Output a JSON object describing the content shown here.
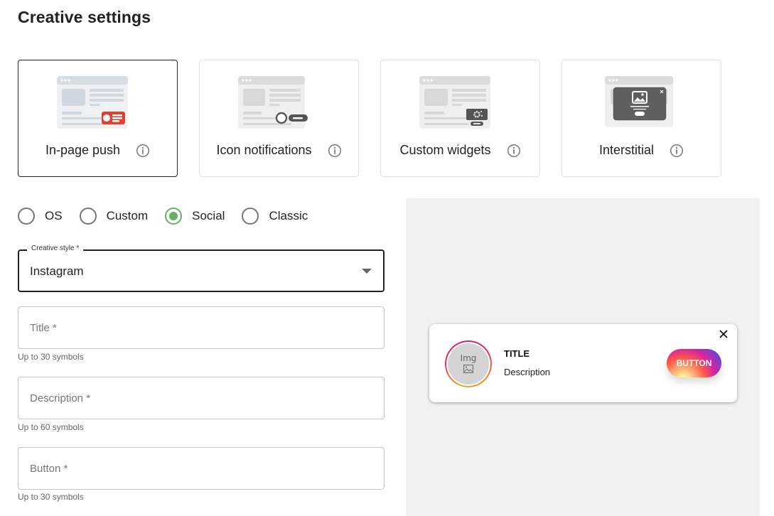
{
  "page": {
    "title": "Creative settings"
  },
  "creative_types": [
    {
      "id": "in-page-push",
      "label": "In-page push",
      "selected": true,
      "illustration": "in-page-push-illustration",
      "accent": "#e0402d"
    },
    {
      "id": "icon-notifications",
      "label": "Icon notifications",
      "selected": false,
      "illustration": "icon-notifications-illustration",
      "accent": "#555555"
    },
    {
      "id": "custom-widgets",
      "label": "Custom widgets",
      "selected": false,
      "illustration": "custom-widgets-illustration",
      "accent": "#555555"
    },
    {
      "id": "interstitial",
      "label": "Interstitial",
      "selected": false,
      "illustration": "interstitial-illustration",
      "accent": "#555555"
    }
  ],
  "info_icon": "info-icon",
  "style_options": [
    {
      "label": "OS",
      "checked": false
    },
    {
      "label": "Custom",
      "checked": false
    },
    {
      "label": "Social",
      "checked": true
    },
    {
      "label": "Classic",
      "checked": false
    }
  ],
  "creative_style": {
    "label": "Creative style *",
    "value": "Instagram"
  },
  "fields": {
    "title": {
      "placeholder": "Title *",
      "value": "",
      "helper": "Up to 30 symbols"
    },
    "description": {
      "placeholder": "Description *",
      "value": "",
      "helper": "Up to 60 symbols"
    },
    "button": {
      "placeholder": "Button *",
      "value": "",
      "helper": "Up to 30 symbols"
    }
  },
  "preview": {
    "image_text": "Img",
    "title": "TITLE",
    "description": "Description",
    "button_label": "BUTTON",
    "close_icon": "close-icon"
  },
  "colors": {
    "radio_checked": "#66b066",
    "selected_border": "#222222",
    "preview_bg": "#f1f1f1"
  }
}
